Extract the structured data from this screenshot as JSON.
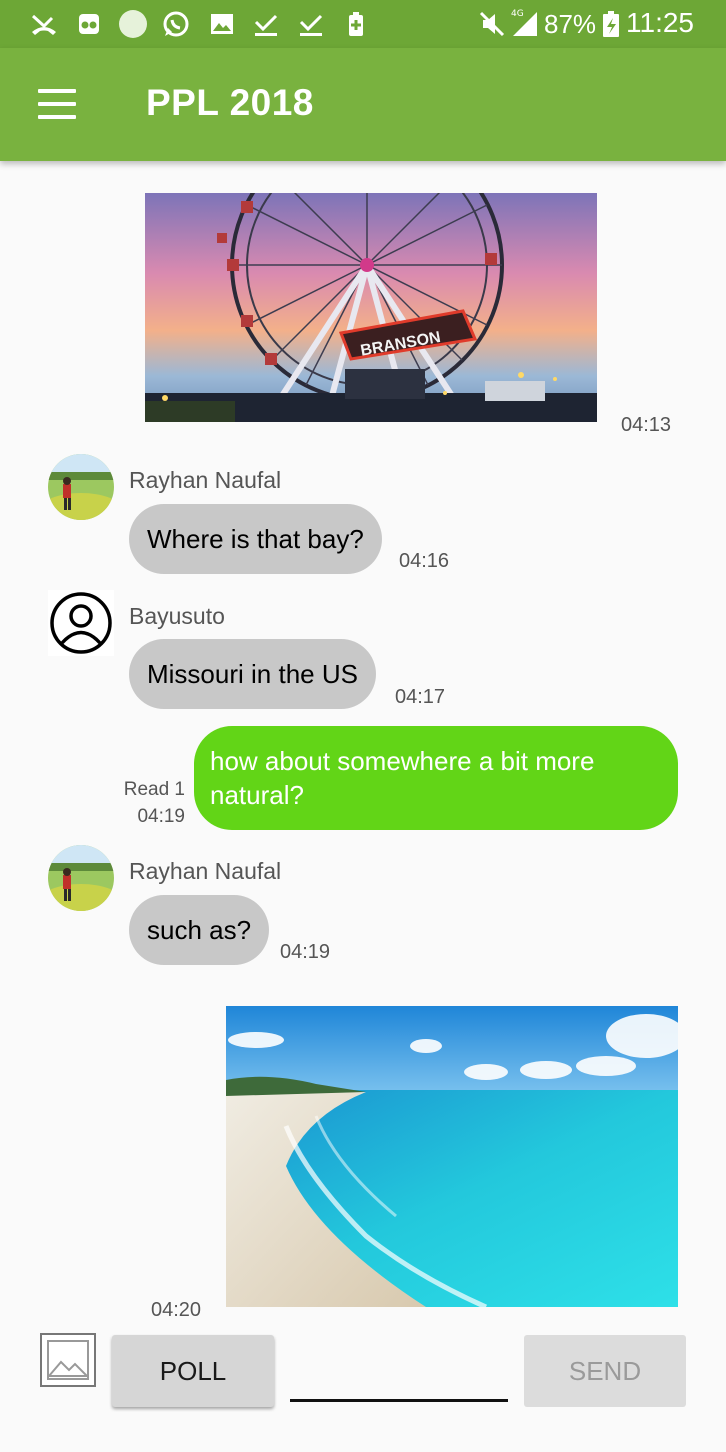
{
  "status_bar": {
    "battery_percent": "87%",
    "clock": "11:25",
    "network": "4G",
    "icons": [
      "missed-call-icon",
      "tripadvisor-icon",
      "dot-icon",
      "whatsapp-icon",
      "gallery-icon",
      "download-done-icon",
      "download-done-icon",
      "battery-saver-icon",
      "mute-icon",
      "signal-icon",
      "battery-icon"
    ]
  },
  "app_bar": {
    "title": "PPL 2018",
    "menu_icon": "hamburger-menu-icon"
  },
  "messages": [
    {
      "type": "image",
      "direction": "incoming",
      "image": "ferris-wheel-photo",
      "time": "04:13"
    },
    {
      "type": "text",
      "direction": "incoming",
      "sender": "Rayhan Naufal",
      "text": "Where is that bay?",
      "time": "04:16"
    },
    {
      "type": "text",
      "direction": "incoming",
      "sender": "Bayusuto",
      "text": "Missouri in the US",
      "time": "04:17"
    },
    {
      "type": "text",
      "direction": "outgoing",
      "text": "how about somewhere a bit more natural?",
      "read": "Read 1",
      "time": "04:19"
    },
    {
      "type": "text",
      "direction": "incoming",
      "sender": "Rayhan Naufal",
      "text": "such as?",
      "time": "04:19"
    },
    {
      "type": "image",
      "direction": "outgoing",
      "image": "beach-photo",
      "time": "04:20"
    }
  ],
  "composer": {
    "gallery_icon": "image-picker-icon",
    "poll_label": "POLL",
    "input_value": "",
    "input_placeholder": "",
    "send_label": "SEND"
  },
  "colors": {
    "status_bar": "#6da736",
    "app_bar": "#79b23f",
    "incoming_bubble": "#c8c8c8",
    "outgoing_bubble": "#62d517"
  }
}
